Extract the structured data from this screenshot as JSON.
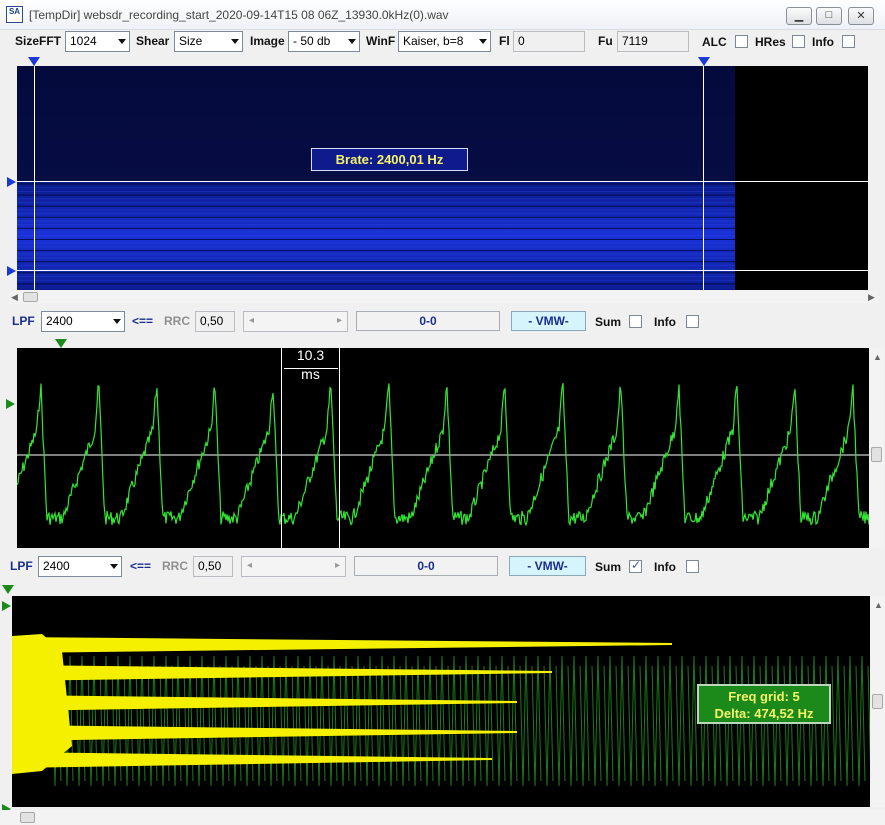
{
  "window": {
    "icon_text": "SA",
    "title": "[TempDir] websdr_recording_start_2020-09-14T15 08 06Z_13930.0kHz(0).wav"
  },
  "toolbar": {
    "sizefft_label": "SizeFFT",
    "sizefft_value": "1024",
    "shear_label": "Shear",
    "shear_value": "Size",
    "image_label": "Image",
    "image_value": "- 50 db",
    "winf_label": "WinF",
    "winf_value": "Kaiser, b=8",
    "fl_label": "Fl",
    "fl_value": "0",
    "fu_label": "Fu",
    "fu_value": "7119",
    "alc_label": "ALC",
    "hres_label": "HRes",
    "info_label": "Info"
  },
  "spectrogram": {
    "brate_label": "Brate: 2400,01 Hz"
  },
  "panel2_toolbar": {
    "lpf_label": "LPF",
    "lpf_value": "2400",
    "back_label": "<==",
    "rrc_label": "RRC",
    "rrc_value": "0,50",
    "range_value": "0-0",
    "vmw_label": "- VMW-",
    "sum_label": "Sum",
    "sum_checked": false,
    "info_label": "Info"
  },
  "waveform": {
    "measure_value": "10.3",
    "measure_unit": "ms",
    "color": "#33e633"
  },
  "panel3_toolbar": {
    "lpf_label": "LPF",
    "lpf_value": "2400",
    "back_label": "<==",
    "rrc_label": "RRC",
    "rrc_value": "0,50",
    "range_value": "0-0",
    "vmw_label": "- VMW-",
    "sum_label": "Sum",
    "sum_checked": true,
    "info_label": "Info"
  },
  "correlation": {
    "freq_grid_label": "Freq grid: 5",
    "delta_label": "Delta: 474,52 Hz",
    "color": "#f4f000"
  }
}
